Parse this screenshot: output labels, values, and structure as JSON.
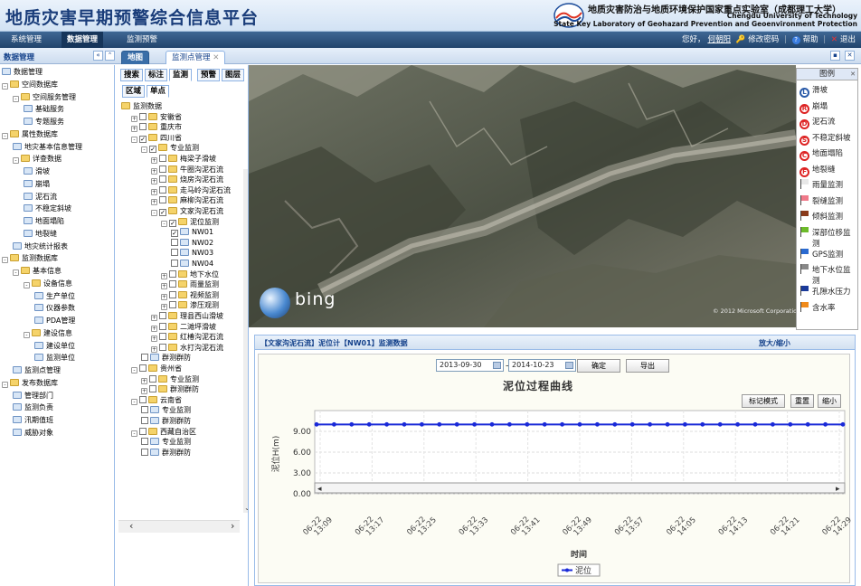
{
  "header": {
    "app_title": "地质灾害早期预警综合信息平台",
    "lab_cn": "地质灾害防治与地质环境保护国家重点实验室（成都理工大学）",
    "lab_en1": "Chengdu University of Technology",
    "lab_en2": "State Key Laboratory of Geohazard Prevention and Geoenvironment Protection"
  },
  "menu": {
    "items": [
      "系统管理",
      "数据管理",
      "监测预警"
    ],
    "active_index": 1
  },
  "userbar": {
    "greeting": "您好，",
    "user": "何朝阳",
    "change_password": "修改密码",
    "help": "帮助",
    "logout": "退出"
  },
  "left_panel": {
    "title": "数据管理",
    "collapse_label": "«",
    "expand_label": "«"
  },
  "tabs": [
    {
      "label": "地图"
    },
    {
      "label": "监测点管理",
      "closable": true
    }
  ],
  "left_tree": [
    {
      "label": "数据管理",
      "level": 0,
      "type": "leaf"
    },
    {
      "label": "空间数据库",
      "level": 0,
      "type": "folder",
      "pm": "-"
    },
    {
      "label": "空间服务管理",
      "level": 1,
      "type": "folder",
      "pm": "-"
    },
    {
      "label": "基础服务",
      "level": 2,
      "type": "leaf"
    },
    {
      "label": "专题服务",
      "level": 2,
      "type": "leaf"
    },
    {
      "label": "属性数据库",
      "level": 0,
      "type": "folder",
      "pm": "-"
    },
    {
      "label": "地灾基本信息管理",
      "level": 1,
      "type": "leaf"
    },
    {
      "label": "详查数据",
      "level": 1,
      "type": "folder",
      "pm": "-"
    },
    {
      "label": "滑坡",
      "level": 2,
      "type": "leaf"
    },
    {
      "label": "崩塌",
      "level": 2,
      "type": "leaf"
    },
    {
      "label": "泥石流",
      "level": 2,
      "type": "leaf"
    },
    {
      "label": "不稳定斜坡",
      "level": 2,
      "type": "leaf"
    },
    {
      "label": "地面塌陷",
      "level": 2,
      "type": "leaf"
    },
    {
      "label": "地裂缝",
      "level": 2,
      "type": "leaf"
    },
    {
      "label": "地灾统计报表",
      "level": 1,
      "type": "leaf"
    },
    {
      "label": "监测数据库",
      "level": 0,
      "type": "folder",
      "pm": "-"
    },
    {
      "label": "基本信息",
      "level": 1,
      "type": "folder",
      "pm": "-"
    },
    {
      "label": "设备信息",
      "level": 2,
      "type": "folder",
      "pm": "-"
    },
    {
      "label": "生产单位",
      "level": 3,
      "type": "leaf"
    },
    {
      "label": "仪器参数",
      "level": 3,
      "type": "leaf"
    },
    {
      "label": "PDA管理",
      "level": 3,
      "type": "leaf"
    },
    {
      "label": "建设信息",
      "level": 2,
      "type": "folder",
      "pm": "-"
    },
    {
      "label": "建设单位",
      "level": 3,
      "type": "leaf"
    },
    {
      "label": "监测单位",
      "level": 3,
      "type": "leaf"
    },
    {
      "label": "监测点管理",
      "level": 1,
      "type": "leaf"
    },
    {
      "label": "发布数据库",
      "level": 0,
      "type": "folder",
      "pm": "-"
    },
    {
      "label": "管理部门",
      "level": 1,
      "type": "leaf"
    },
    {
      "label": "监测负责",
      "level": 1,
      "type": "leaf"
    },
    {
      "label": "汛期值班",
      "level": 1,
      "type": "leaf"
    },
    {
      "label": "威胁对象",
      "level": 1,
      "type": "leaf"
    }
  ],
  "mid_tabs_row1": [
    "搜索",
    "标注",
    "监测",
    "预警",
    "图层"
  ],
  "mid_tabs_row1_active": 2,
  "mid_tabs_row2": [
    "区域",
    "单点"
  ],
  "mid_tabs_row2_active": 1,
  "mid_tree": [
    {
      "label": "监测数据",
      "level": 0,
      "type": "folder",
      "pm": "",
      "cb": ""
    },
    {
      "label": "安徽省",
      "level": 1,
      "type": "folder",
      "pm": "+",
      "cb": " "
    },
    {
      "label": "重庆市",
      "level": 1,
      "type": "folder",
      "pm": "+",
      "cb": " "
    },
    {
      "label": "四川省",
      "level": 1,
      "type": "folder",
      "pm": "-",
      "cb": "✓"
    },
    {
      "label": "专业监测",
      "level": 2,
      "type": "folder",
      "pm": "-",
      "cb": "✓"
    },
    {
      "label": "梅梁子滑坡",
      "level": 3,
      "type": "folder",
      "pm": "+",
      "cb": " "
    },
    {
      "label": "牛圈沟泥石流",
      "level": 3,
      "type": "folder",
      "pm": "+",
      "cb": " "
    },
    {
      "label": "烧房沟泥石流",
      "level": 3,
      "type": "folder",
      "pm": "+",
      "cb": " "
    },
    {
      "label": "走马岭沟泥石流",
      "level": 3,
      "type": "folder",
      "pm": "+",
      "cb": " "
    },
    {
      "label": "麻柳沟泥石流",
      "level": 3,
      "type": "folder",
      "pm": "+",
      "cb": " "
    },
    {
      "label": "文家沟泥石流",
      "level": 3,
      "type": "folder",
      "pm": "-",
      "cb": "✓"
    },
    {
      "label": "泥位监测",
      "level": 4,
      "type": "folder",
      "pm": "-",
      "cb": "✓"
    },
    {
      "label": "NW01",
      "level": 5,
      "type": "leaf",
      "pm": "",
      "cb": "✓"
    },
    {
      "label": "NW02",
      "level": 5,
      "type": "leaf",
      "pm": "",
      "cb": " "
    },
    {
      "label": "NW03",
      "level": 5,
      "type": "leaf",
      "pm": "",
      "cb": " "
    },
    {
      "label": "NW04",
      "level": 5,
      "type": "leaf",
      "pm": "",
      "cb": " "
    },
    {
      "label": "地下水位",
      "level": 4,
      "type": "folder",
      "pm": "+",
      "cb": " "
    },
    {
      "label": "雨量监测",
      "level": 4,
      "type": "folder",
      "pm": "+",
      "cb": " "
    },
    {
      "label": "视频监测",
      "level": 4,
      "type": "folder",
      "pm": "+",
      "cb": " "
    },
    {
      "label": "渗压观测",
      "level": 4,
      "type": "folder",
      "pm": "+",
      "cb": " "
    },
    {
      "label": "理县西山滑坡",
      "level": 3,
      "type": "folder",
      "pm": "+",
      "cb": " "
    },
    {
      "label": "二滩坪滑坡",
      "level": 3,
      "type": "folder",
      "pm": "+",
      "cb": " "
    },
    {
      "label": "红椿沟泥石流",
      "level": 3,
      "type": "folder",
      "pm": "+",
      "cb": " "
    },
    {
      "label": "水打沟泥石流",
      "level": 3,
      "type": "folder",
      "pm": "+",
      "cb": " "
    },
    {
      "label": "群测群防",
      "level": 2,
      "type": "leaf",
      "pm": "",
      "cb": " "
    },
    {
      "label": "贵州省",
      "level": 1,
      "type": "folder",
      "pm": "-",
      "cb": " "
    },
    {
      "label": "专业监测",
      "level": 2,
      "type": "folder",
      "pm": "+",
      "cb": " "
    },
    {
      "label": "群测群防",
      "level": 2,
      "type": "folder",
      "pm": "+",
      "cb": " "
    },
    {
      "label": "云南省",
      "level": 1,
      "type": "folder",
      "pm": "-",
      "cb": " "
    },
    {
      "label": "专业监测",
      "level": 2,
      "type": "leaf",
      "pm": "",
      "cb": " "
    },
    {
      "label": "群测群防",
      "level": 2,
      "type": "leaf",
      "pm": "",
      "cb": " "
    },
    {
      "label": "西藏自治区",
      "level": 1,
      "type": "folder",
      "pm": "-",
      "cb": " "
    },
    {
      "label": "专业监测",
      "level": 2,
      "type": "leaf",
      "pm": "",
      "cb": " "
    },
    {
      "label": "群测群防",
      "level": 2,
      "type": "leaf",
      "pm": "",
      "cb": " "
    }
  ],
  "map": {
    "brand": "bing",
    "copyright": "© 2012 Microsoft Corporation"
  },
  "legend": {
    "title": "图例",
    "items": [
      {
        "label": "滑坡",
        "kind": "circle",
        "letter": "L",
        "color": "blue"
      },
      {
        "label": "崩塌",
        "kind": "circle",
        "letter": "R",
        "color": "red"
      },
      {
        "label": "泥石流",
        "kind": "circle",
        "letter": "D",
        "color": "red"
      },
      {
        "label": "不稳定斜坡",
        "kind": "circle",
        "letter": "S",
        "color": "red"
      },
      {
        "label": "地面塌陷",
        "kind": "circle",
        "letter": "C",
        "color": "red"
      },
      {
        "label": "地裂缝",
        "kind": "circle",
        "letter": "F",
        "color": "red"
      },
      {
        "label": "雨量监测",
        "kind": "flag",
        "color": "#e8e8e8"
      },
      {
        "label": "裂缝监测",
        "kind": "flag",
        "color": "#f07a8a"
      },
      {
        "label": "倾斜监测",
        "kind": "flag",
        "color": "#8a3a1a"
      },
      {
        "label": "深部位移监",
        "label2": "测",
        "kind": "flag",
        "color": "#6dbb2a"
      },
      {
        "label": "GPS监测",
        "kind": "flag",
        "color": "#2a6ad0"
      },
      {
        "label": "地下水位监",
        "label2": "测",
        "kind": "flag",
        "color": "#888888"
      },
      {
        "label": "孔隙水压力",
        "kind": "flag",
        "color": "#1a3a9a"
      },
      {
        "label": "含水率",
        "kind": "flag",
        "color": "#f08a1a"
      }
    ]
  },
  "chart_panel": {
    "title": "【文家沟泥石流】泥位计【NW01】监测数据",
    "zoom_link": "放大/缩小",
    "date_from": "2013-09-30",
    "date_sep": "→",
    "date_to": "2014-10-23",
    "confirm": "确定",
    "export": "导出",
    "btn_mark": "标记模式",
    "btn_reset": "重置",
    "btn_shrink": "缩小"
  },
  "chart_data": {
    "type": "line",
    "title": "泥位过程曲线",
    "xlabel": "时间",
    "ylabel": "泥位H(m)",
    "ylim": [
      0,
      12
    ],
    "yticks": [
      "0.00",
      "3.00",
      "6.00",
      "9.00"
    ],
    "ytick_values": [
      0,
      3,
      6,
      9
    ],
    "categories": [
      "06-22 13:09",
      "06-22 13:17",
      "06-22 13:25",
      "06-22 13:33",
      "06-22 13:41",
      "06-22 13:49",
      "06-22 13:57",
      "06-22 14:05",
      "06-22 14:13",
      "06-22 14:21",
      "06-22 14:29"
    ],
    "series": [
      {
        "name": "泥位",
        "color": "#1a2ad8",
        "values": [
          10,
          10,
          10,
          10,
          10,
          10,
          10,
          10,
          10,
          10,
          10,
          10,
          10,
          10,
          10,
          10,
          10,
          10,
          10,
          10,
          10,
          10,
          10,
          10,
          10,
          10,
          10,
          10,
          10,
          10,
          10
        ]
      }
    ]
  }
}
